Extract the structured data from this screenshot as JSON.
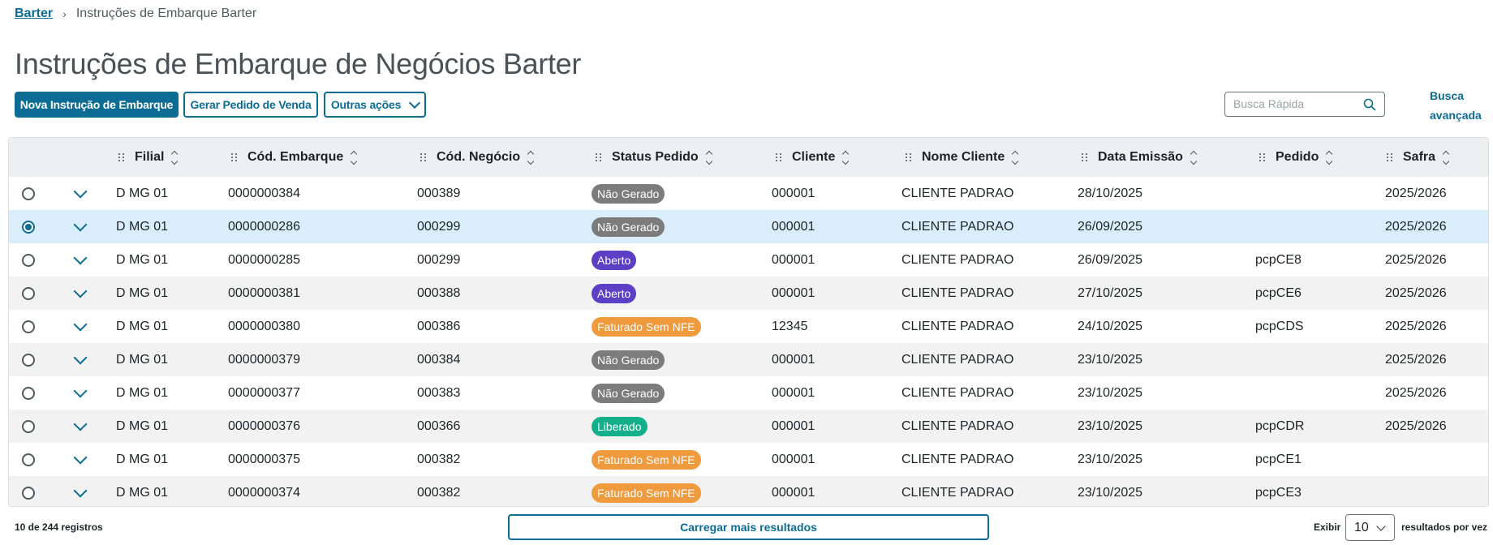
{
  "breadcrumb": {
    "root": "Barter",
    "current": "Instruções de Embarque Barter"
  },
  "page": {
    "title": "Instruções de Embarque de Negócios Barter"
  },
  "toolbar": {
    "new_label": "Nova Instrução de Embarque",
    "order_label": "Gerar Pedido de Venda",
    "other_label": "Outras ações"
  },
  "search": {
    "placeholder": "Busca Rápida",
    "advanced_label": "Busca avançada"
  },
  "table": {
    "columns": [
      "Filial",
      "Cód. Embarque",
      "Cód. Negócio",
      "Status Pedido",
      "Cliente",
      "Nome Cliente",
      "Data Emissão",
      "Pedido",
      "Safra"
    ],
    "status_colors": {
      "Não Gerado": "#7c7c7c",
      "Aberto": "#5b3fc4",
      "Faturado Sem NFE": "#ee9a3d",
      "Liberado": "#14b08c"
    },
    "selected_index": 1,
    "rows": [
      {
        "filial": "D MG 01",
        "embarque": "0000000384",
        "negocio": "000389",
        "status": "Não Gerado",
        "cliente": "000001",
        "nome": "CLIENTE PADRAO",
        "data": "28/10/2025",
        "pedido": "",
        "safra": "2025/2026"
      },
      {
        "filial": "D MG 01",
        "embarque": "0000000286",
        "negocio": "000299",
        "status": "Não Gerado",
        "cliente": "000001",
        "nome": "CLIENTE PADRAO",
        "data": "26/09/2025",
        "pedido": "",
        "safra": "2025/2026"
      },
      {
        "filial": "D MG 01",
        "embarque": "0000000285",
        "negocio": "000299",
        "status": "Aberto",
        "cliente": "000001",
        "nome": "CLIENTE PADRAO",
        "data": "26/09/2025",
        "pedido": "pcpCE8",
        "safra": "2025/2026"
      },
      {
        "filial": "D MG 01",
        "embarque": "0000000381",
        "negocio": "000388",
        "status": "Aberto",
        "cliente": "000001",
        "nome": "CLIENTE PADRAO",
        "data": "27/10/2025",
        "pedido": "pcpCE6",
        "safra": "2025/2026"
      },
      {
        "filial": "D MG 01",
        "embarque": "0000000380",
        "negocio": "000386",
        "status": "Faturado Sem NFE",
        "cliente": "12345",
        "nome": "CLIENTE PADRAO",
        "data": "24/10/2025",
        "pedido": "pcpCDS",
        "safra": "2025/2026"
      },
      {
        "filial": "D MG 01",
        "embarque": "0000000379",
        "negocio": "000384",
        "status": "Não Gerado",
        "cliente": "000001",
        "nome": "CLIENTE PADRAO",
        "data": "23/10/2025",
        "pedido": "",
        "safra": "2025/2026"
      },
      {
        "filial": "D MG 01",
        "embarque": "0000000377",
        "negocio": "000383",
        "status": "Não Gerado",
        "cliente": "000001",
        "nome": "CLIENTE PADRAO",
        "data": "23/10/2025",
        "pedido": "",
        "safra": "2025/2026"
      },
      {
        "filial": "D MG 01",
        "embarque": "0000000376",
        "negocio": "000366",
        "status": "Liberado",
        "cliente": "000001",
        "nome": "CLIENTE PADRAO",
        "data": "23/10/2025",
        "pedido": "pcpCDR",
        "safra": "2025/2026"
      },
      {
        "filial": "D MG 01",
        "embarque": "0000000375",
        "negocio": "000382",
        "status": "Faturado Sem NFE",
        "cliente": "000001",
        "nome": "CLIENTE PADRAO",
        "data": "23/10/2025",
        "pedido": "pcpCE1",
        "safra": ""
      },
      {
        "filial": "D MG 01",
        "embarque": "0000000374",
        "negocio": "000382",
        "status": "Faturado Sem NFE",
        "cliente": "000001",
        "nome": "CLIENTE PADRAO",
        "data": "23/10/2025",
        "pedido": "pcpCE3",
        "safra": ""
      }
    ]
  },
  "footer": {
    "count": "10 de 244 registros",
    "load_more": "Carregar mais resultados",
    "show_label": "Exibir",
    "page_size": "10",
    "per_page_label": "resultados por vez"
  }
}
